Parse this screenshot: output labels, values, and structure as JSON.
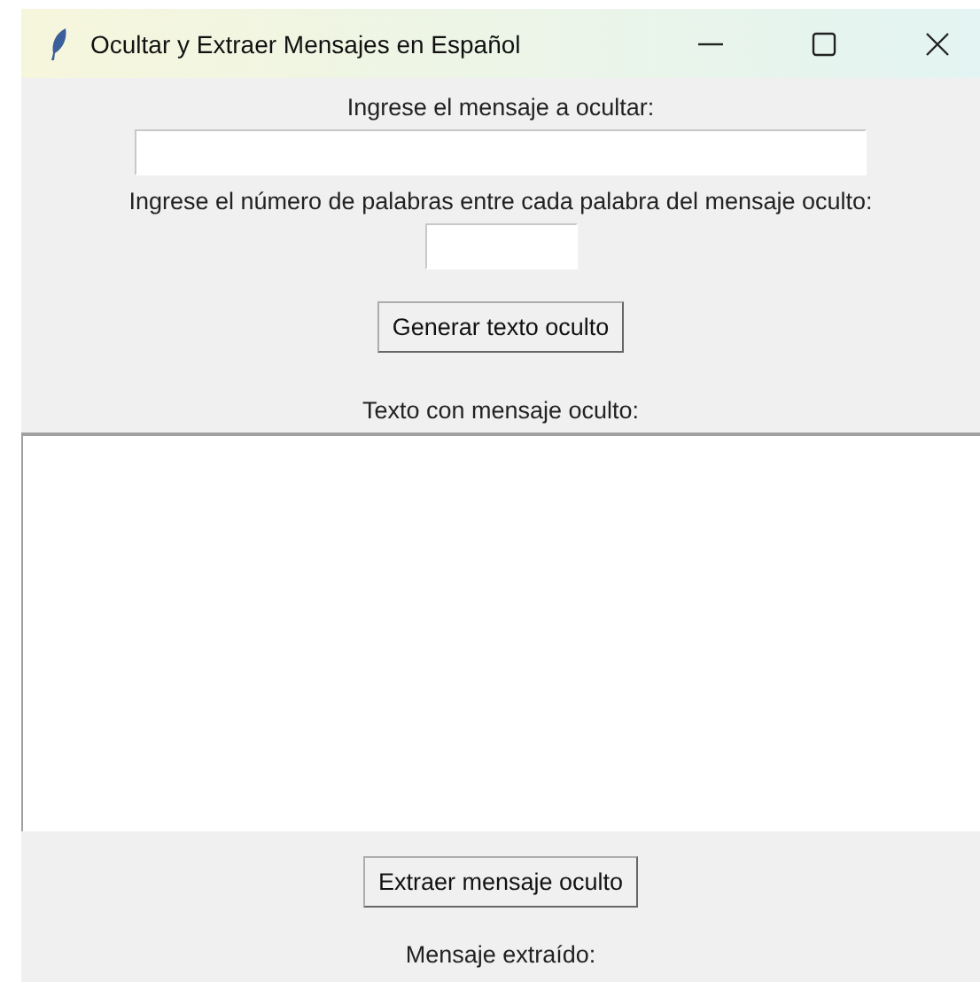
{
  "window": {
    "title": "Ocultar y Extraer Mensajes en Español"
  },
  "form": [
    {
      "kind": "label",
      "text": "Ingrese el mensaje a ocultar:"
    },
    {
      "kind": "entry"
    },
    {
      "kind": "label",
      "text": "Ingrese el número de palabras entre cada palabra del mensaje oculto:"
    },
    {
      "kind": "short_entry"
    },
    {
      "kind": "button",
      "text": "Generar texto oculto"
    },
    {
      "kind": "label",
      "text": "Texto con mensaje oculto:"
    },
    {
      "kind": "textarea"
    },
    {
      "kind": "button",
      "text": "Extraer mensaje oculto"
    },
    {
      "kind": "label",
      "text": "Mensaje extraído:"
    }
  ]
}
